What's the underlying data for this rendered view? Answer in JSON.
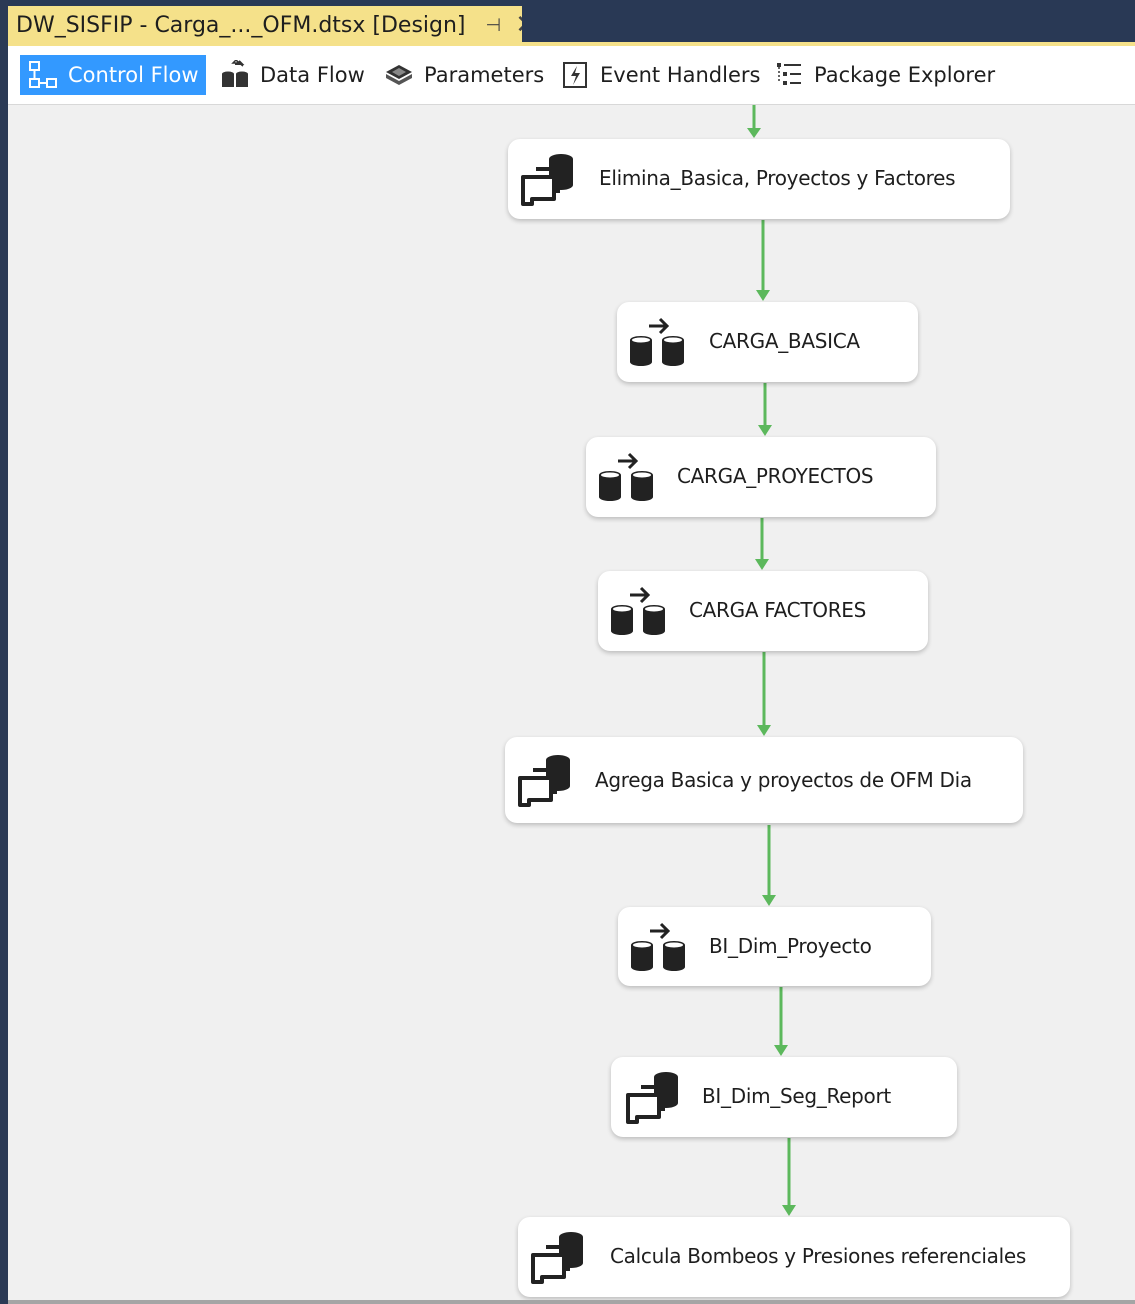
{
  "document_tab": {
    "title": "DW_SISFIP - Carga_..._OFM.dtsx [Design]",
    "pin_glyph": "⊣",
    "close_glyph": "✕"
  },
  "designer_tabs": [
    {
      "label": "Control Flow",
      "icon": "control-flow-icon",
      "active": true
    },
    {
      "label": "Data Flow",
      "icon": "data-flow-icon",
      "active": false
    },
    {
      "label": "Parameters",
      "icon": "parameters-icon",
      "active": false
    },
    {
      "label": "Event Handlers",
      "icon": "event-handlers-icon",
      "active": false
    },
    {
      "label": "Package Explorer",
      "icon": "package-explorer-icon",
      "active": false
    }
  ],
  "tasks": [
    {
      "label": "Elimina_Basica, Proyectos y Factores",
      "icon": "execute-sql-task-icon"
    },
    {
      "label": "CARGA_BASICA",
      "icon": "data-flow-task-icon"
    },
    {
      "label": "CARGA_PROYECTOS",
      "icon": "data-flow-task-icon"
    },
    {
      "label": "CARGA FACTORES",
      "icon": "data-flow-task-icon"
    },
    {
      "label": "Agrega Basica y proyectos de OFM Dia",
      "icon": "execute-sql-task-icon"
    },
    {
      "label": "BI_Dim_Proyecto",
      "icon": "data-flow-task-icon"
    },
    {
      "label": "BI_Dim_Seg_Report",
      "icon": "execute-sql-task-icon"
    },
    {
      "label": "Calcula Bombeos y Presiones referenciales",
      "icon": "execute-sql-task-icon"
    }
  ],
  "colors": {
    "active_tab": "#3399ff",
    "document_tab": "#f5e18a",
    "precedence_constraint": "#5cb85c",
    "canvas": "#f0f0f0"
  }
}
